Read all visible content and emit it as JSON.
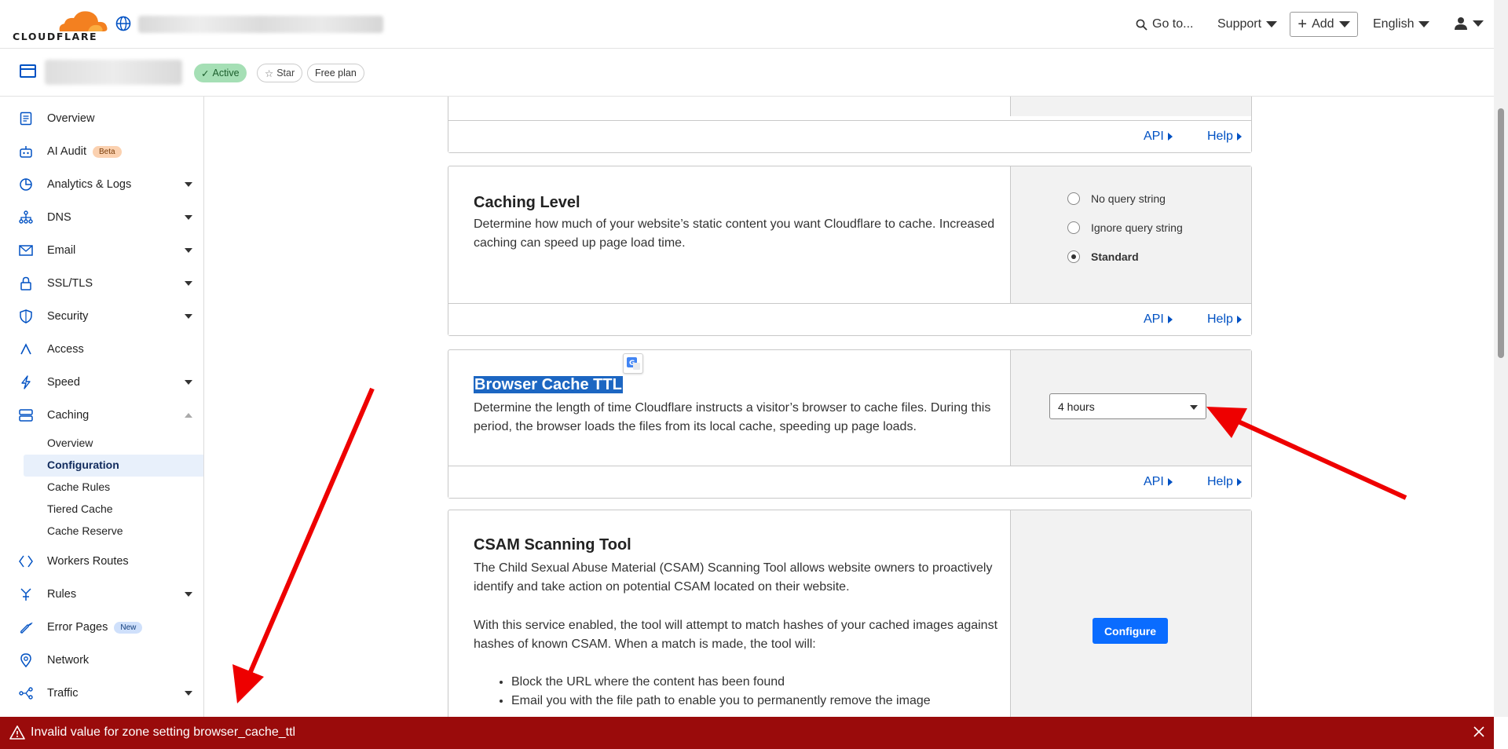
{
  "header": {
    "logo_text": "CLOUDFLARE",
    "goto_label": "Go to...",
    "support_label": "Support",
    "add_label": "Add",
    "language_label": "English"
  },
  "zone": {
    "status": "Active",
    "star_label": "Star",
    "plan": "Free plan"
  },
  "sidebar": {
    "items": [
      {
        "label": "Overview",
        "icon": "document-icon"
      },
      {
        "label": "AI Audit",
        "icon": "robot-icon",
        "badge": "Beta"
      },
      {
        "label": "Analytics & Logs",
        "icon": "chart-pie-icon"
      },
      {
        "label": "DNS",
        "icon": "network-tree-icon"
      },
      {
        "label": "Email",
        "icon": "envelope-icon"
      },
      {
        "label": "SSL/TLS",
        "icon": "lock-icon"
      },
      {
        "label": "Security",
        "icon": "shield-icon"
      },
      {
        "label": "Access",
        "icon": "access-icon"
      },
      {
        "label": "Speed",
        "icon": "lightning-icon"
      },
      {
        "label": "Caching",
        "icon": "storage-icon"
      },
      {
        "label": "Workers Routes",
        "icon": "workers-icon"
      },
      {
        "label": "Rules",
        "icon": "rules-icon"
      },
      {
        "label": "Error Pages",
        "icon": "wrench-icon",
        "badge": "New"
      },
      {
        "label": "Network",
        "icon": "pin-icon"
      },
      {
        "label": "Traffic",
        "icon": "traffic-icon"
      }
    ],
    "caching_sub": [
      "Overview",
      "Configuration",
      "Cache Rules",
      "Tiered Cache",
      "Cache Reserve"
    ]
  },
  "cards": {
    "api_label": "API",
    "help_label": "Help",
    "caching_level": {
      "title": "Caching Level",
      "description": "Determine how much of your website’s static content you want Cloudflare to cache. Increased caching can speed up page load time.",
      "options": [
        "No query string",
        "Ignore query string",
        "Standard"
      ],
      "selected": "Standard"
    },
    "browser_cache_ttl": {
      "title": "Browser Cache TTL",
      "description": "Determine the length of time Cloudflare instructs a visitor’s browser to cache files. During this period, the browser loads the files from its local cache, speeding up page loads.",
      "selected_value": "4 hours"
    },
    "csam": {
      "title": "CSAM Scanning Tool",
      "description1": "The Child Sexual Abuse Material (CSAM) Scanning Tool allows website owners to proactively identify and take action on potential CSAM located on their website.",
      "description2": "With this service enabled, the tool will attempt to match hashes of your cached images against hashes of known CSAM. When a match is made, the tool will:",
      "bullets": [
        "Block the URL where the content has been found",
        "Email you with the file path to enable you to permanently remove the image"
      ],
      "configure_label": "Configure"
    }
  },
  "error": {
    "message": "Invalid value for zone setting browser_cache_ttl"
  },
  "colors": {
    "brand_orange": "#f38020",
    "link_blue": "#0051c3",
    "error_red": "#9a0b0b",
    "annotation_red": "#ee0000"
  }
}
